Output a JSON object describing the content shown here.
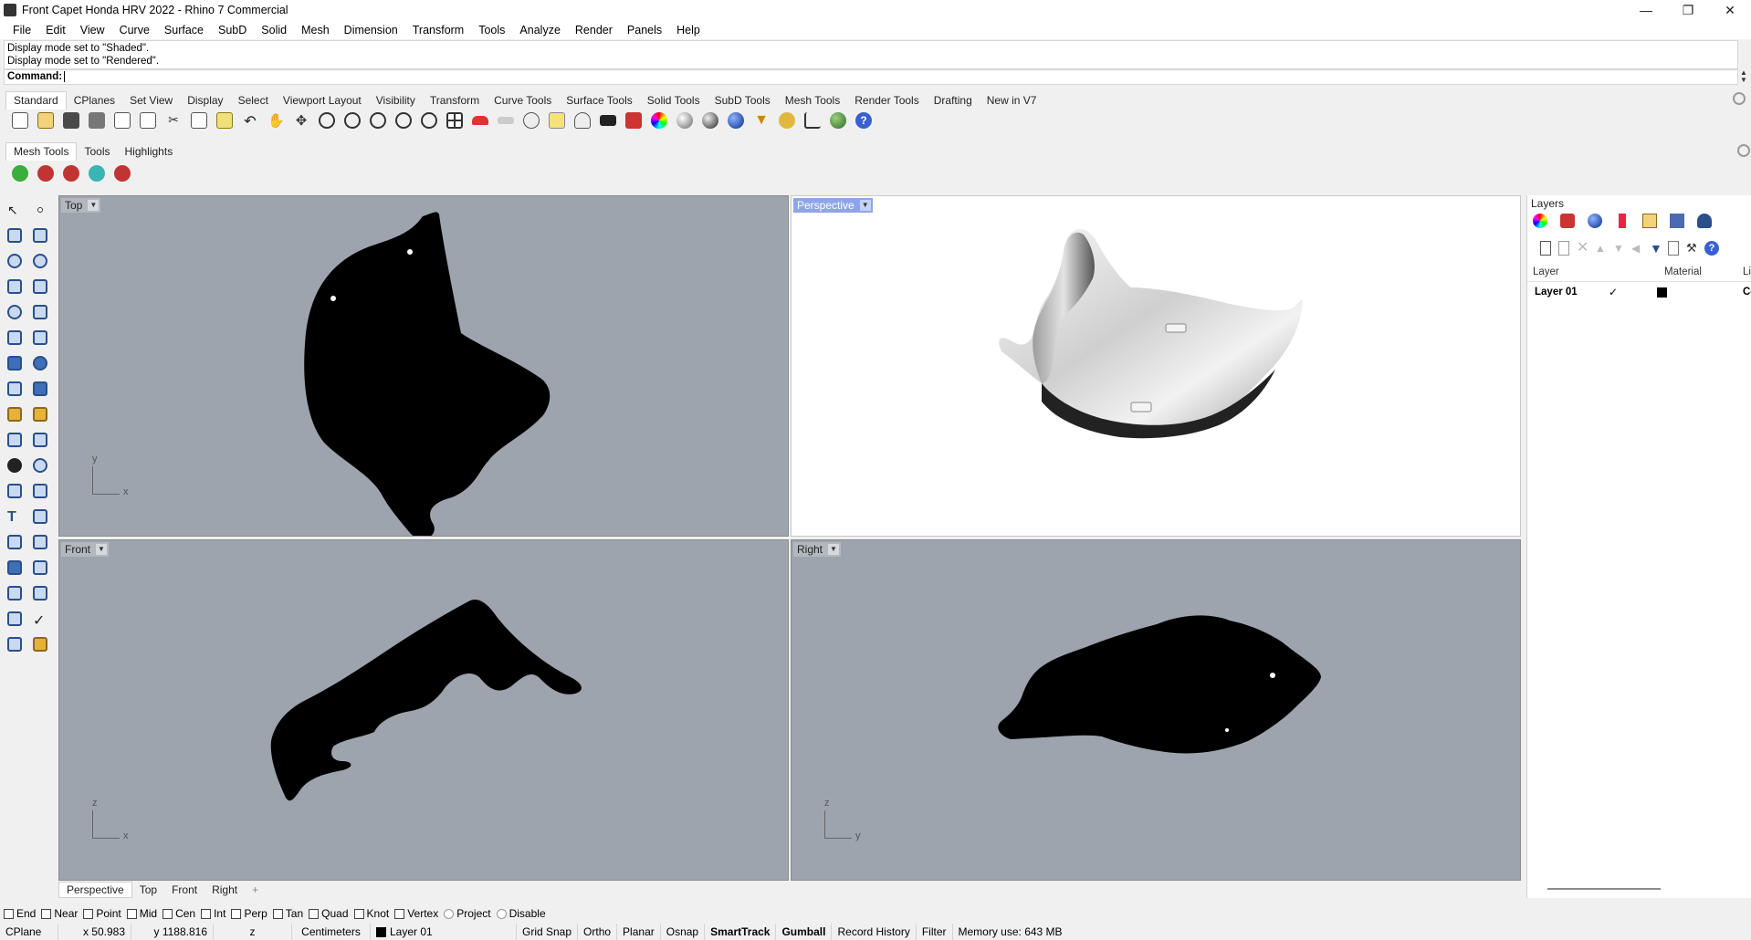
{
  "window": {
    "title": "Front Capet Honda HRV 2022 - Rhino 7 Commercial"
  },
  "menu": [
    "File",
    "Edit",
    "View",
    "Curve",
    "Surface",
    "SubD",
    "Solid",
    "Mesh",
    "Dimension",
    "Transform",
    "Tools",
    "Analyze",
    "Render",
    "Panels",
    "Help"
  ],
  "command": {
    "history": [
      "Display mode set to \"Shaded\".",
      "Display mode set to \"Rendered\"."
    ],
    "prompt": "Command:"
  },
  "toolbar_tabs": [
    "Standard",
    "CPlanes",
    "Set View",
    "Display",
    "Select",
    "Viewport Layout",
    "Visibility",
    "Transform",
    "Curve Tools",
    "Surface Tools",
    "Solid Tools",
    "SubD Tools",
    "Mesh Tools",
    "Render Tools",
    "Drafting",
    "New in V7"
  ],
  "toolbar_tabs_active": "Standard",
  "sub_tabs": [
    "Mesh Tools",
    "Tools",
    "Highlights"
  ],
  "viewports": {
    "top": {
      "label": "Top",
      "axis_h": "x",
      "axis_v": "y"
    },
    "perspective": {
      "label": "Perspective"
    },
    "front": {
      "label": "Front",
      "axis_h": "x",
      "axis_v": "z"
    },
    "right": {
      "label": "Right",
      "axis_h": "y",
      "axis_v": "z"
    }
  },
  "viewport_tabs": [
    "Perspective",
    "Top",
    "Front",
    "Right"
  ],
  "viewport_tab_add": "+",
  "layers": {
    "title": "Layers",
    "col_layer": "Layer",
    "col_material": "Material",
    "col_li": "Li",
    "row_name": "Layer 01",
    "row_check": "✓",
    "row_tail": "Cc"
  },
  "osnaps": [
    {
      "label": "End",
      "type": "check"
    },
    {
      "label": "Near",
      "type": "check"
    },
    {
      "label": "Point",
      "type": "check"
    },
    {
      "label": "Mid",
      "type": "check"
    },
    {
      "label": "Cen",
      "type": "check"
    },
    {
      "label": "Int",
      "type": "check"
    },
    {
      "label": "Perp",
      "type": "check"
    },
    {
      "label": "Tan",
      "type": "check"
    },
    {
      "label": "Quad",
      "type": "check"
    },
    {
      "label": "Knot",
      "type": "check"
    },
    {
      "label": "Vertex",
      "type": "check"
    },
    {
      "label": "Project",
      "type": "radio"
    },
    {
      "label": "Disable",
      "type": "radio"
    }
  ],
  "status": {
    "cplane": "CPlane",
    "x": "x 50.983",
    "y": "y 1188.816",
    "z": "z",
    "units": "Centimeters",
    "layer": "Layer 01",
    "grid_snap": "Grid Snap",
    "ortho": "Ortho",
    "planar": "Planar",
    "osnap": "Osnap",
    "smarttrack": "SmartTrack",
    "gumball": "Gumball",
    "record_history": "Record History",
    "filter": "Filter",
    "memory": "Memory use: 643 MB"
  }
}
